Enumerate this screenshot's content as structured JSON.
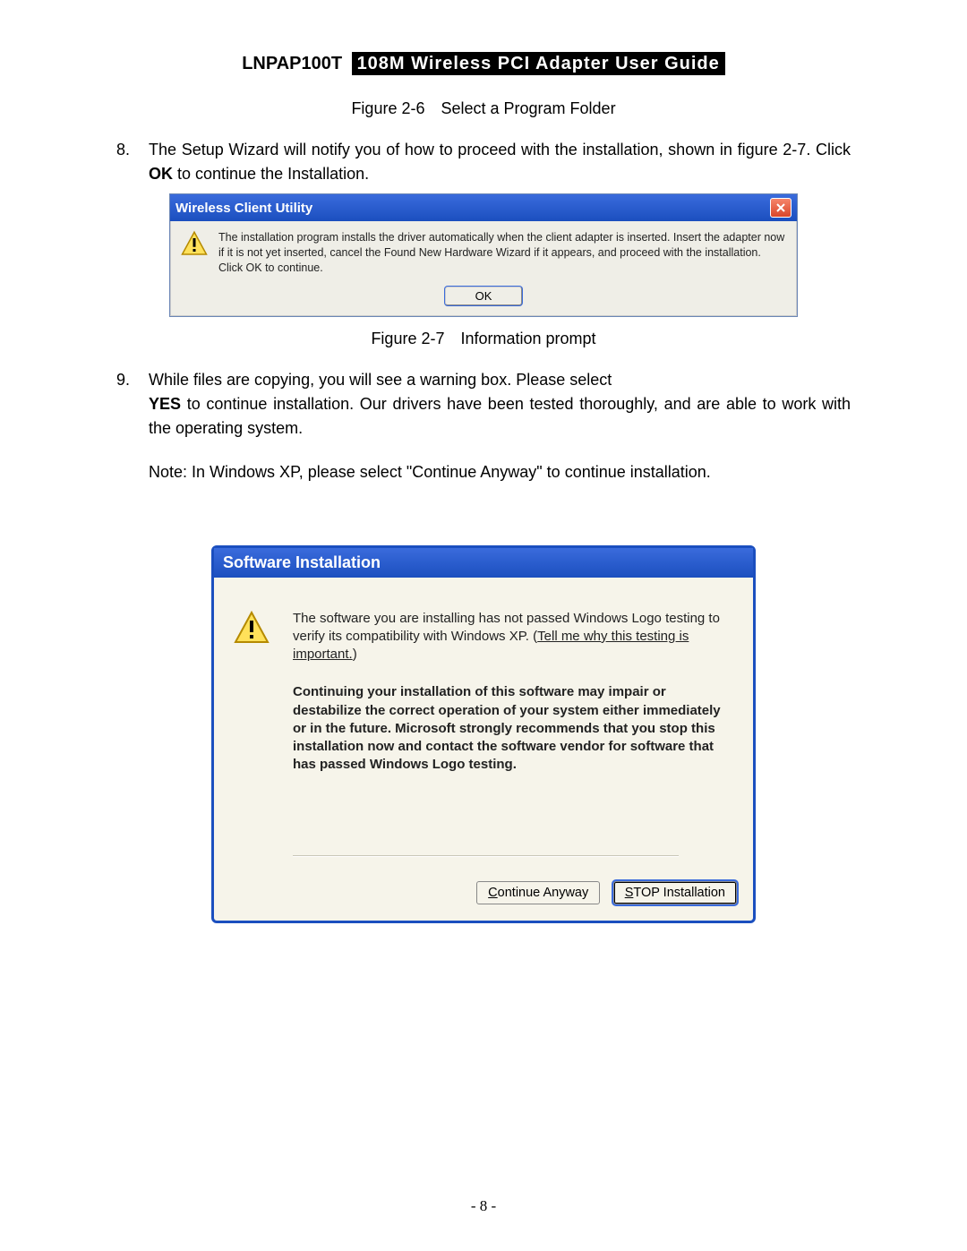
{
  "header": {
    "model": "LNPAP100T",
    "title": "108M Wireless PCI Adapter User Guide"
  },
  "caption_2_6": "Figure 2-6 Select a Program Folder",
  "item8": {
    "num": "8.",
    "text_a": "The Setup Wizard will notify you of how to proceed with the installation, shown in figure 2-7. Click ",
    "ok": "OK",
    "text_b": " to continue the Installation."
  },
  "dlg1": {
    "title": "Wireless Client Utility",
    "body": "The installation program installs the driver automatically when the client adapter is inserted. Insert the adapter now if it is not yet inserted, cancel the Found New Hardware Wizard if it appears, and proceed with the installation. Click OK to continue.",
    "ok": "OK"
  },
  "caption_2_7": "Figure 2-7 Information prompt",
  "item9": {
    "num": "9.",
    "line1": "While files are copying, you will see a warning box. Please select",
    "yes": "YES",
    "line2_rest": " to continue installation. Our drivers have been tested thoroughly, and are able to work with the operating system.",
    "note": "Note: In Windows XP, please select \"Continue Anyway\" to continue installation."
  },
  "dlg2": {
    "title": "Software Installation",
    "p1a": "The software you are installing has not passed Windows Logo testing to verify its compatibility with Windows XP. (",
    "link": "Tell me why this testing is important.",
    "p1b": ")",
    "p2": "Continuing your installation of this software may impair or destabilize the correct operation of your system either immediately or in the future. Microsoft strongly recommends that you stop this installation now and contact the software vendor for software that has passed Windows Logo testing.",
    "btn_continue_u": "C",
    "btn_continue_rest": "ontinue Anyway",
    "btn_stop_pre": "",
    "btn_stop_u": "S",
    "btn_stop_rest": "TOP Installation"
  },
  "page_number": "- 8 -"
}
